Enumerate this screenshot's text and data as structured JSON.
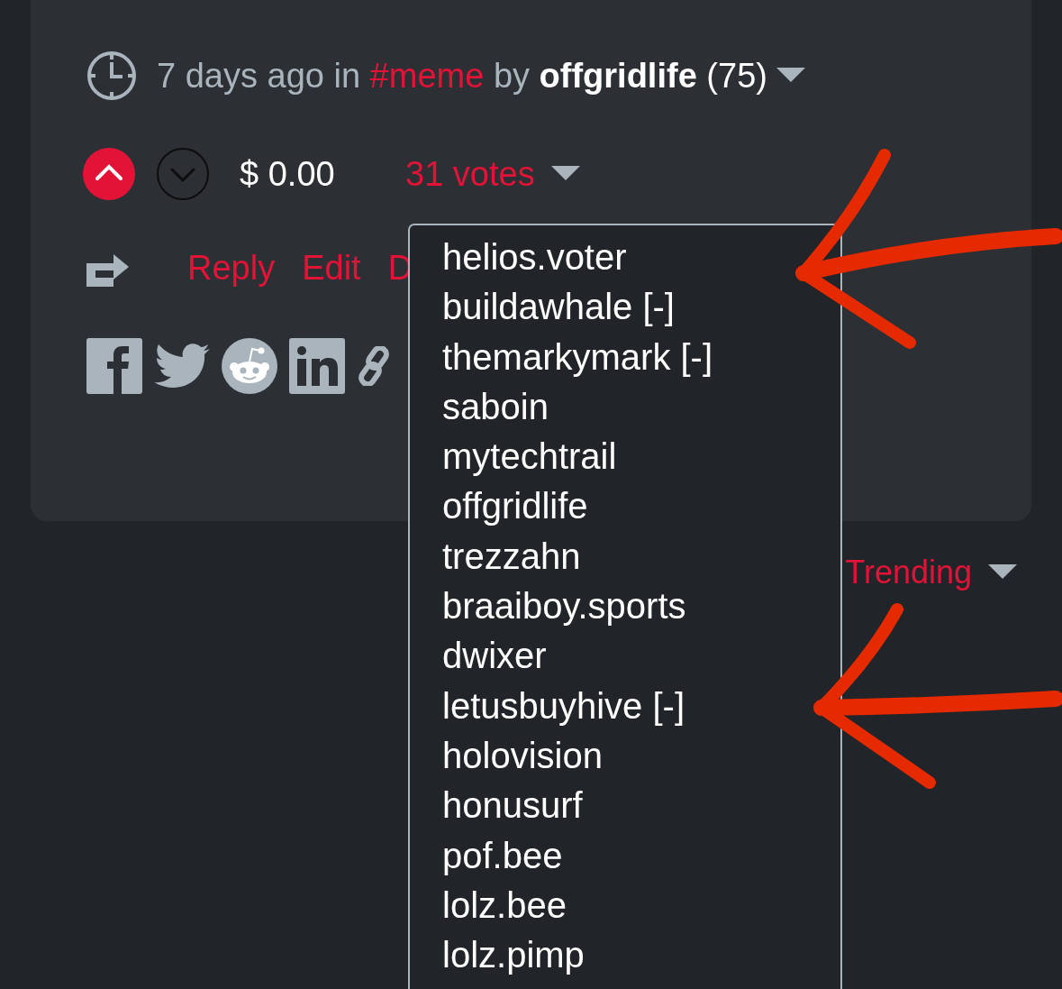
{
  "post_meta": {
    "time": "7 days ago in",
    "tag": "#meme",
    "by_word": "by",
    "author": "offgridlife",
    "reputation": "(75)"
  },
  "voting": {
    "upvoted": true,
    "downvoted": false,
    "payout": "$ 0.00",
    "votes": "31 votes"
  },
  "actions": [
    "Reply",
    "Edit",
    "D"
  ],
  "sort": {
    "label": "Trending"
  },
  "voters_menu": {
    "voters": [
      "helios.voter",
      "buildawhale [-]",
      "themarkymark [-]",
      "saboin",
      "mytechtrail",
      "offgridlife",
      "trezzahn",
      "braaiboy.sports",
      "dwixer",
      "letusbuyhive [-]",
      "holovision",
      "honusurf",
      "pof.bee",
      "lolz.bee",
      "lolz.pimp"
    ]
  }
}
